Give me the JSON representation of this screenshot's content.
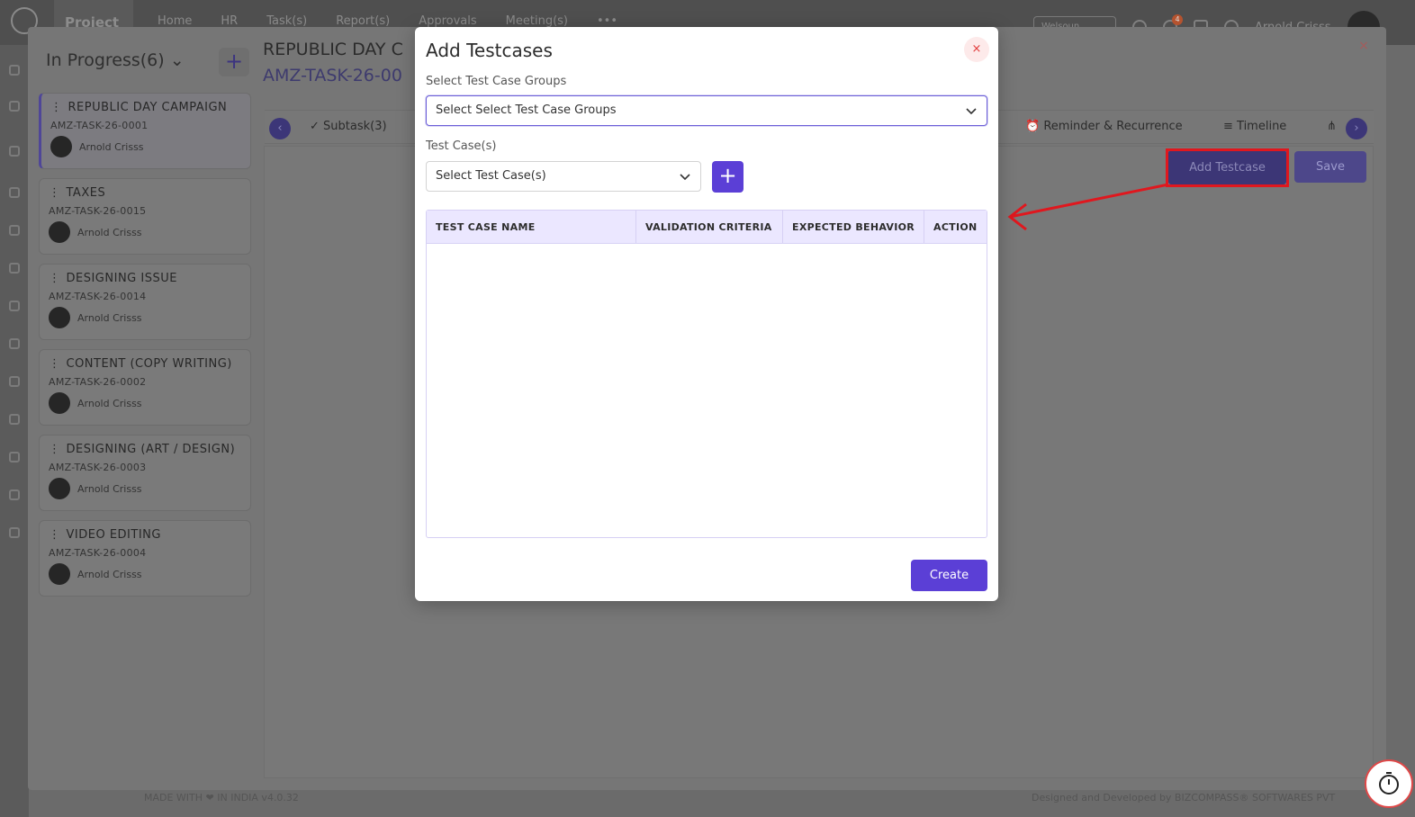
{
  "app": {
    "brand": "Project",
    "nav": [
      "Home",
      "HR",
      "Task(s)",
      "Report(s)",
      "Approvals",
      "Meeting(s)",
      "•••"
    ],
    "workspace": "Welsoun",
    "notification_count": "4",
    "user_name": "Arnold Crisss",
    "footer_left": "MADE WITH ❤ IN INDIA v4.0.32",
    "footer_right": "Designed and Developed by BIZCOMPASS® SOFTWARES PVT"
  },
  "panel": {
    "status_title": "In Progress(6)",
    "status_chevron": "⌄",
    "add_label": "+",
    "close_label": "×",
    "task_title": "REPUBLIC DAY C",
    "task_code": "AMZ-TASK-26-00",
    "tabs": {
      "subtask": "Subtask(3)",
      "reminder": "Reminder & Recurrence",
      "timeline": "Timeline"
    },
    "add_testcase_label": "Add Testcase",
    "save_label": "Save",
    "cards": [
      {
        "title": "REPUBLIC DAY CAMPAIGN",
        "code": "AMZ-TASK-26-0001",
        "assignee": "Arnold Crisss"
      },
      {
        "title": "TAXES",
        "code": "AMZ-TASK-26-0015",
        "assignee": "Arnold Crisss"
      },
      {
        "title": "DESIGNING ISSUE",
        "code": "AMZ-TASK-26-0014",
        "assignee": "Arnold Crisss"
      },
      {
        "title": "CONTENT (COPY WRITING)",
        "code": "AMZ-TASK-26-0002",
        "assignee": "Arnold Crisss"
      },
      {
        "title": "DESIGNING (ART / DESIGN)",
        "code": "AMZ-TASK-26-0003",
        "assignee": "Arnold Crisss"
      },
      {
        "title": "VIDEO EDITING",
        "code": "AMZ-TASK-26-0004",
        "assignee": "Arnold Crisss"
      }
    ]
  },
  "modal": {
    "title": "Add Testcases",
    "close_label": "×",
    "group_label": "Select Test Case Groups",
    "group_value": "Select Select Test Case Groups",
    "case_label": "Test Case(s)",
    "case_value": "Select Test Case(s)",
    "add_label": "+",
    "columns": [
      "TEST CASE NAME",
      "VALIDATION CRITERIA",
      "EXPECTED BEHAVIOR",
      "ACTION"
    ],
    "rows": [],
    "create_label": "Create"
  },
  "colors": {
    "accent": "#5b3fd6",
    "header_bg": "#ebe7ff",
    "annotation_red": "#e0171e"
  }
}
